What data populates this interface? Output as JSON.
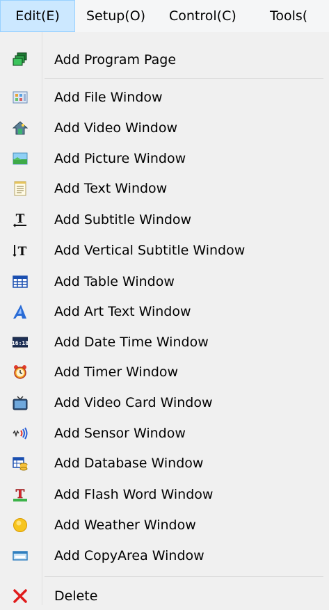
{
  "menubar": {
    "items": [
      {
        "label": "Edit(E)",
        "active": true
      },
      {
        "label": "Setup(O)"
      },
      {
        "label": "Control(C)"
      },
      {
        "label": "Tools("
      }
    ]
  },
  "menu": {
    "items": [
      {
        "label": "Add Program Page",
        "icon": "program-page-icon"
      },
      {
        "label": "Add File Window",
        "icon": "file-window-icon"
      },
      {
        "label": "Add Video Window",
        "icon": "video-window-icon"
      },
      {
        "label": "Add Picture Window",
        "icon": "picture-window-icon"
      },
      {
        "label": "Add Text Window",
        "icon": "text-window-icon"
      },
      {
        "label": "Add Subtitle Window",
        "icon": "subtitle-window-icon"
      },
      {
        "label": "Add Vertical Subtitle Window",
        "icon": "vertical-subtitle-icon"
      },
      {
        "label": "Add Table Window",
        "icon": "table-window-icon"
      },
      {
        "label": "Add Art Text Window",
        "icon": "art-text-icon"
      },
      {
        "label": "Add Date Time Window",
        "icon": "date-time-icon",
        "icon_text": "16:18"
      },
      {
        "label": "Add Timer Window",
        "icon": "timer-alarm-icon"
      },
      {
        "label": "Add Video Card Window",
        "icon": "video-card-icon"
      },
      {
        "label": "Add Sensor Window",
        "icon": "sensor-icon"
      },
      {
        "label": "Add Database Window",
        "icon": "database-window-icon"
      },
      {
        "label": "Add Flash Word Window",
        "icon": "flash-word-icon"
      },
      {
        "label": "Add Weather Window",
        "icon": "weather-icon"
      },
      {
        "label": "Add CopyArea Window",
        "icon": "copyarea-icon"
      },
      {
        "label": "Delete",
        "icon": "delete-icon"
      }
    ]
  }
}
